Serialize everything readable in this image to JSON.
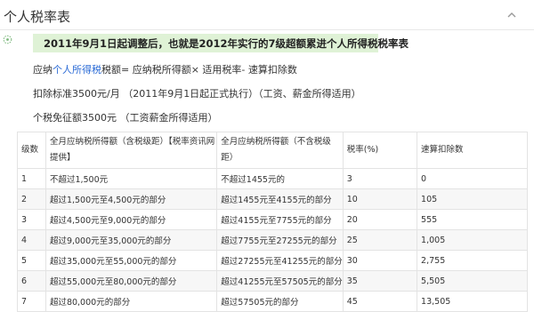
{
  "header": {
    "title": "个人税率表"
  },
  "intro": {
    "highlight": "2011年9月1日起调整后，也就是2012年实行的7级超额累进个人所得税税率表",
    "formula_prefix": "应纳",
    "formula_link": "个人所得税",
    "formula_suffix": "税额= 应纳税所得额× 适用税率- 速算扣除数",
    "deduction": "扣除标准3500元/月 （2011年9月1日起正式执行）（工资、薪金所得适用）",
    "exemption": "个税免征额3500元 （工资薪金所得适用）"
  },
  "table": {
    "headers": [
      "级数",
      "全月应纳税所得额（含税级距）【税率资讯网提供】",
      "全月应纳税所得额（不含税级距）",
      "税率(%)",
      "速算扣除数"
    ],
    "rows": [
      [
        "1",
        "不超过1,500元",
        "不超过1455元的",
        "3",
        "0"
      ],
      [
        "2",
        "超过1,500元至4,500元的部分",
        "超过1455元至4155元的部分",
        "10",
        "105"
      ],
      [
        "3",
        "超过4,500元至9,000元的部分",
        "超过4155元至7755元的部分",
        "20",
        "555"
      ],
      [
        "4",
        "超过9,000元至35,000元的部分",
        "超过7755元至27255元的部分",
        "25",
        "1,005"
      ],
      [
        "5",
        "超过35,000元至55,000元的部分",
        "超过27255元至41255元的部分",
        "30",
        "2,755"
      ],
      [
        "6",
        "超过55,000元至80,000元的部分",
        "超过41255元至57505元的部分",
        "35",
        "5,505"
      ],
      [
        "7",
        "超过80,000元的部分",
        "超过57505元的部分",
        "45",
        "13,505"
      ]
    ]
  }
}
